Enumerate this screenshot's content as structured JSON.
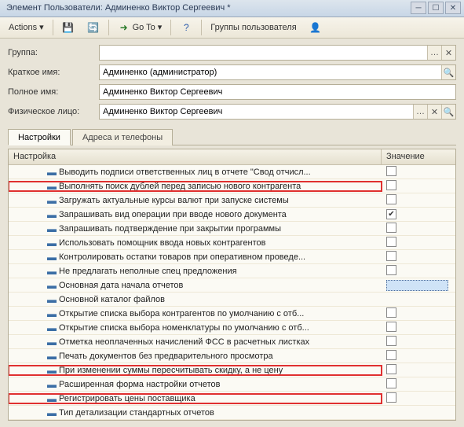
{
  "title": "Элемент Пользователи: Админенко Виктор Сергеевич *",
  "toolbar": {
    "actions": "Actions",
    "goto": "Go To",
    "groups": "Группы пользователя"
  },
  "form": {
    "group_label": "Группа:",
    "group_value": "",
    "short_label": "Краткое имя:",
    "short_value": "Админенко (администратор)",
    "full_label": "Полное имя:",
    "full_value": "Админенко Виктор Сергеевич",
    "person_label": "Физическое лицо:",
    "person_value": "Админенко Виктор Сергеевич"
  },
  "tabs": {
    "settings": "Настройки",
    "addr": "Адреса и телефоны"
  },
  "grid": {
    "col_name": "Настройка",
    "col_value": "Значение",
    "rows": [
      {
        "indent": 3,
        "text": "Выводить подписи ответственных лиц в отчете \"Свод отчисл...",
        "val": "chk",
        "checked": false,
        "hl": false
      },
      {
        "indent": 3,
        "text": "Выполнять поиск дублей перед записью нового контрагента",
        "val": "chk",
        "checked": false,
        "hl": true
      },
      {
        "indent": 3,
        "text": "Загружать актуальные курсы валют при запуске системы",
        "val": "chk",
        "checked": false,
        "hl": false
      },
      {
        "indent": 3,
        "text": "Запрашивать вид операции при вводе нового документа",
        "val": "chk",
        "checked": true,
        "hl": false
      },
      {
        "indent": 3,
        "text": "Запрашивать подтверждение при закрытии программы",
        "val": "chk",
        "checked": false,
        "hl": false
      },
      {
        "indent": 3,
        "text": "Использовать помощник ввода новых контрагентов",
        "val": "chk",
        "checked": false,
        "hl": false
      },
      {
        "indent": 3,
        "text": "Контролировать остатки товаров при оперативном проведе...",
        "val": "chk",
        "checked": false,
        "hl": false
      },
      {
        "indent": 3,
        "text": "Не предлагать неполные спец предложения",
        "val": "chk",
        "checked": false,
        "hl": false
      },
      {
        "indent": 3,
        "text": "Основная дата начала отчетов",
        "val": "selected",
        "hl": false
      },
      {
        "indent": 3,
        "text": "Основной каталог файлов",
        "val": "",
        "hl": false
      },
      {
        "indent": 3,
        "text": "Открытие списка выбора контрагентов по умолчанию с отб...",
        "val": "chk",
        "checked": false,
        "hl": false
      },
      {
        "indent": 3,
        "text": "Открытие списка выбора номенклатуры по умолчанию с отб...",
        "val": "chk",
        "checked": false,
        "hl": false
      },
      {
        "indent": 3,
        "text": "Отметка неоплаченных начислений ФСС в расчетных листках",
        "val": "chk",
        "checked": false,
        "hl": false
      },
      {
        "indent": 3,
        "text": "Печать документов без предварительного просмотра",
        "val": "chk",
        "checked": false,
        "hl": false
      },
      {
        "indent": 3,
        "text": "При изменении суммы пересчитывать скидку, а не цену",
        "val": "chk",
        "checked": false,
        "hl": true
      },
      {
        "indent": 3,
        "text": "Расширенная форма настройки отчетов",
        "val": "chk",
        "checked": false,
        "hl": false
      },
      {
        "indent": 3,
        "text": "Регистрировать цены поставщика",
        "val": "chk",
        "checked": false,
        "hl": true
      },
      {
        "indent": 3,
        "text": "Тип детализации стандартных отчетов",
        "val": "",
        "hl": false
      }
    ]
  }
}
